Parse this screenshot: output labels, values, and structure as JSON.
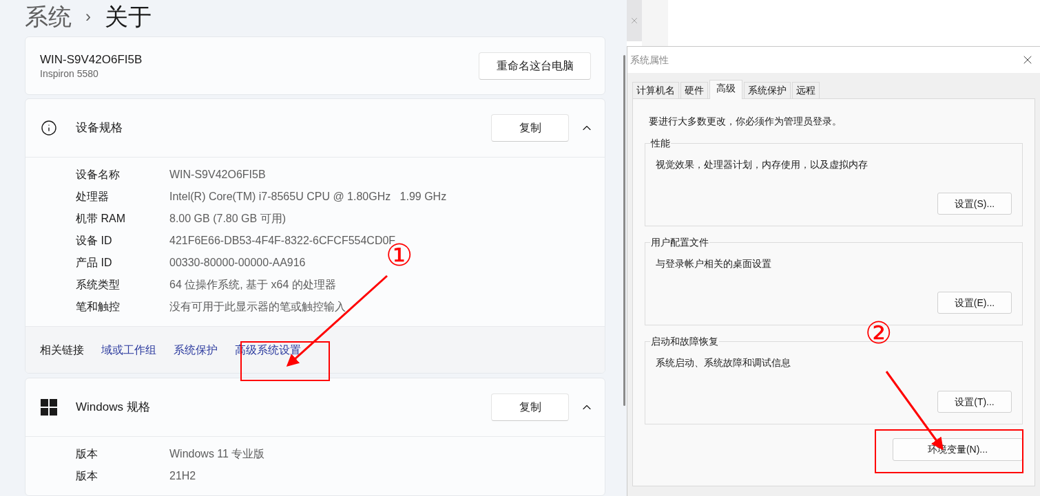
{
  "settings": {
    "breadcrumb": {
      "parent": "系统",
      "separator": "›",
      "current": "关于"
    },
    "pc_card": {
      "name": "WIN-S9V42O6FI5B",
      "model": "Inspiron 5580",
      "rename_button": "重命名这台电脑"
    },
    "sections": [
      {
        "kind": "device",
        "title": "设备规格",
        "copy_button": "复制",
        "expanded": true,
        "rows": [
          {
            "label": "设备名称",
            "value": "WIN-S9V42O6FI5B"
          },
          {
            "label": "处理器",
            "value": "Intel(R) Core(TM) i7-8565U CPU @ 1.80GHz   1.99 GHz"
          },
          {
            "label": "机带 RAM",
            "value": "8.00 GB (7.80 GB 可用)"
          },
          {
            "label": "设备 ID",
            "value": "421F6E66-DB53-4F4F-8322-6CFCF554CD0F"
          },
          {
            "label": "产品 ID",
            "value": "00330-80000-00000-AA916"
          },
          {
            "label": "系统类型",
            "value": "64 位操作系统, 基于 x64 的处理器"
          },
          {
            "label": "笔和触控",
            "value": "没有可用于此显示器的笔或触控输入"
          }
        ],
        "related_links": {
          "label": "相关链接",
          "links": [
            "域或工作组",
            "系统保护",
            "高级系统设置"
          ]
        }
      },
      {
        "kind": "windows",
        "title": "Windows 规格",
        "copy_button": "复制",
        "expanded": true,
        "rows": [
          {
            "label": "版本",
            "value": "Windows 11 专业版"
          },
          {
            "label": "版本",
            "value": "21H2"
          }
        ]
      }
    ]
  },
  "dialog": {
    "title": "系统属性",
    "tabs": [
      {
        "label": "计算机名",
        "selected": false
      },
      {
        "label": "硬件",
        "selected": false
      },
      {
        "label": "高级",
        "selected": true
      },
      {
        "label": "系统保护",
        "selected": false
      },
      {
        "label": "远程",
        "selected": false
      }
    ],
    "notice": "要进行大多数更改，你必须作为管理员登录。",
    "groups": [
      {
        "title": "性能",
        "description": "视觉效果，处理器计划，内存使用，以及虚拟内存",
        "button": "设置(S)..."
      },
      {
        "title": "用户配置文件",
        "description": "与登录帐户相关的桌面设置",
        "button": "设置(E)..."
      },
      {
        "title": "启动和故障恢复",
        "description": "系统启动、系统故障和调试信息",
        "button": "设置(T)..."
      }
    ],
    "env_button": "环境变量(N)..."
  },
  "annotations": [
    {
      "label": "①"
    },
    {
      "label": "②"
    }
  ]
}
